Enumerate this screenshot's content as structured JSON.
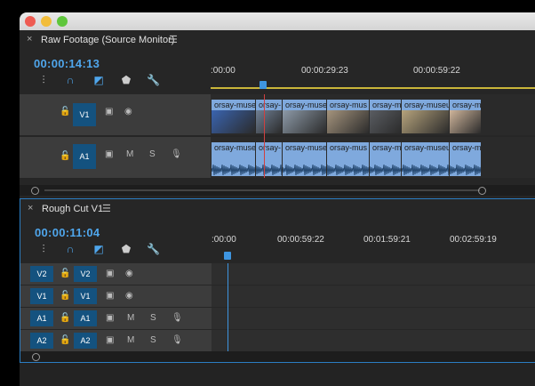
{
  "source_panel": {
    "close_glyph": "×",
    "title": "Raw Footage (Source Monitor)",
    "menu_glyph": "☰",
    "timecode": "00:00:14:13",
    "ruler_labels": [
      ":00:00",
      "00:00:29:23",
      "00:00:59:22"
    ],
    "tracks": {
      "v1": {
        "label": "V1"
      },
      "a1": {
        "label": "A1",
        "mute": "M",
        "solo": "S"
      }
    },
    "clips": [
      "orsay-muse",
      "orsay-",
      "orsay-muse",
      "orsay-mus",
      "orsay-m",
      "orsay-museu",
      "orsay-m"
    ],
    "clip_thumb_colors": [
      "#3a64b0",
      "#6f7f94",
      "#8d9aa8",
      "#a5947d",
      "#5a5d62",
      "#b6a37c",
      "#cfb59b"
    ]
  },
  "sequence_panel": {
    "close_glyph": "×",
    "title": "Rough Cut V1",
    "menu_glyph": "☰",
    "timecode": "00:00:11:04",
    "ruler_labels": [
      ":00:00",
      "00:00:59:22",
      "00:01:59:21",
      "00:02:59:19"
    ],
    "tracks": [
      {
        "source": "V2",
        "target": "V2",
        "type": "video"
      },
      {
        "source": "V1",
        "target": "V1",
        "type": "video"
      },
      {
        "source": "A1",
        "target": "A1",
        "type": "audio",
        "mute": "M",
        "solo": "S"
      },
      {
        "source": "A2",
        "target": "A2",
        "type": "audio",
        "mute": "M",
        "solo": "S"
      }
    ]
  },
  "colors": {
    "accent": "#4fa6ec",
    "track_target": "#14527f",
    "clip": "#7fa9dd"
  }
}
